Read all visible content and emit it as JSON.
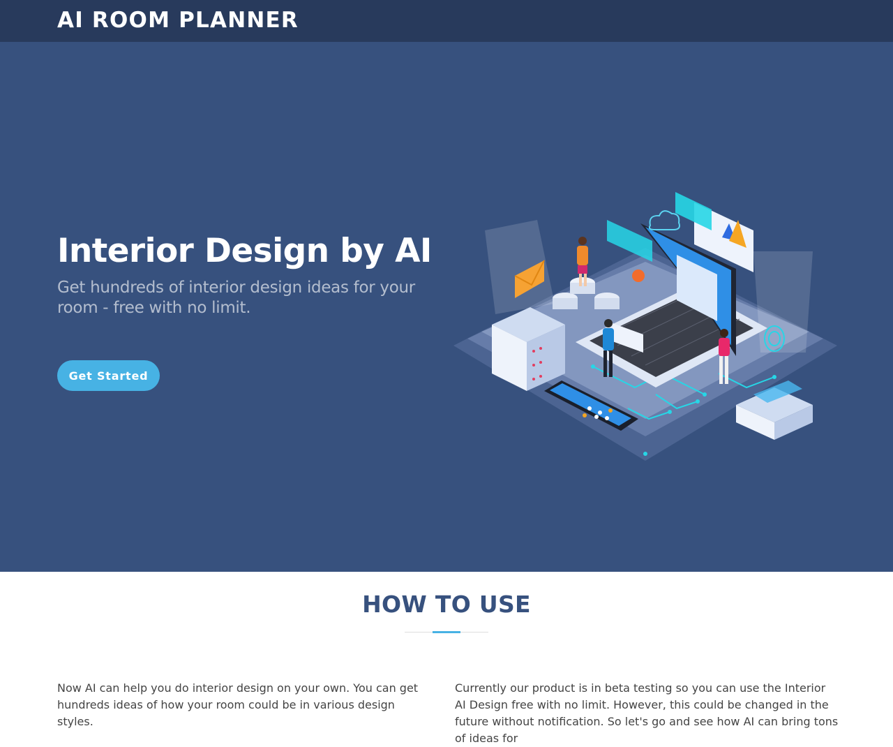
{
  "header": {
    "brand": "AI ROOM PLANNER"
  },
  "hero": {
    "title": "Interior Design by AI",
    "subtitle": "Get hundreds of interior design ideas for your room - free with no limit.",
    "cta_label": "Get Started"
  },
  "how_to_use": {
    "title": "HOW TO USE",
    "left_text": "Now AI can help you do interior design on your own. You can get hundreds ideas of how your room could be in various design styles.",
    "right_text": "Currently our product is in beta testing so you can use the Interior AI Design free with no limit. However, this could be changed in the future without notification. So let's go and see how AI can bring tons of ideas for"
  },
  "colors": {
    "header_bg": "#283a5c",
    "hero_bg": "#37517e",
    "accent": "#47b2e4",
    "section_title": "#37517e"
  }
}
